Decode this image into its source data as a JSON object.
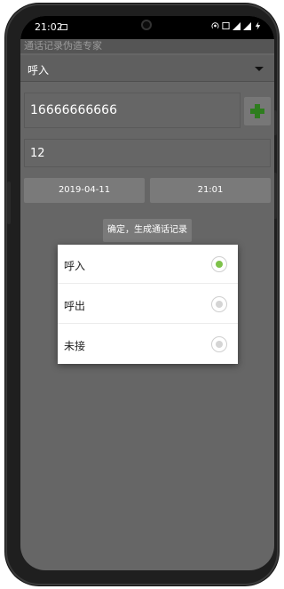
{
  "status_bar": {
    "time": "21:02",
    "icons": [
      "image-notification-icon",
      "hotspot-icon",
      "wifi-icon",
      "cellular-signal-icon",
      "cellular-signal-icon",
      "charging-icon"
    ]
  },
  "app": {
    "title": "通话记录伪造专家"
  },
  "call_type_spinner": {
    "selected": "呼入"
  },
  "phone_number_input": {
    "value": "16666666666"
  },
  "count_input": {
    "value": "12"
  },
  "date_button": {
    "label": "2019-04-11"
  },
  "time_button": {
    "label": "21:01"
  },
  "confirm_button": {
    "label": "确定，生成通话记录"
  },
  "dialog": {
    "options": [
      {
        "label": "呼入",
        "checked": true
      },
      {
        "label": "呼出",
        "checked": false
      },
      {
        "label": "未接",
        "checked": false
      }
    ]
  },
  "colors": {
    "screen_bg": "#666666",
    "dialog_bg": "#ffffff",
    "radio_selected": "#7ec24a",
    "add_button_accent": "#2e7d1e"
  }
}
